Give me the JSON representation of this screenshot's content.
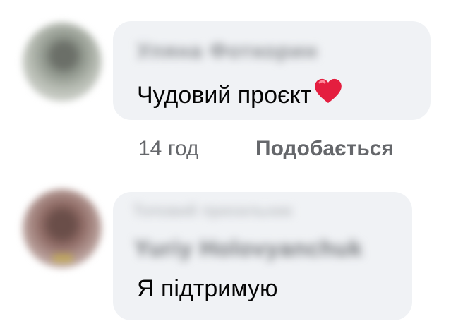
{
  "comments": [
    {
      "author": "Уляна Фоткорин",
      "text": "Чудовий проєкт",
      "reaction_emoji": "heart-icon",
      "time": "14 год",
      "like_label": "Подобається"
    },
    {
      "subtitle": "Топовий прихильник",
      "author": "Yuriy Holovyanchuk",
      "text": "Я підтримую"
    }
  ],
  "colors": {
    "bubble": "#f0f2f5",
    "text": "#050505",
    "meta": "#65676b",
    "heart": "#e41e3f"
  }
}
